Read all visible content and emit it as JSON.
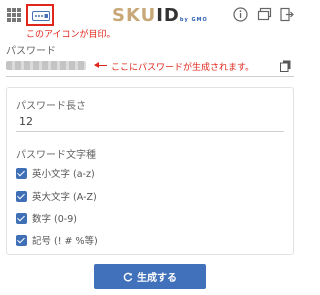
{
  "header": {
    "logo_sku": "SKU",
    "logo_id": "ID",
    "logo_gmo": "by GMO"
  },
  "annotations": {
    "icon_note": "このアイコンが目印。",
    "password_note": "ここにパスワードが生成されます。"
  },
  "password": {
    "label": "パスワード"
  },
  "settings": {
    "length_label": "パスワード長さ",
    "length_value": "12",
    "charset_label": "パスワード文字種",
    "options": [
      {
        "label": "英小文字 (a-z)",
        "checked": true
      },
      {
        "label": "英大文字 (A-Z)",
        "checked": true
      },
      {
        "label": "数字 (0-9)",
        "checked": true
      },
      {
        "label": "記号 (! # %等)",
        "checked": true
      }
    ]
  },
  "generate_button": {
    "label": "生成する"
  },
  "colors": {
    "accent": "#4171bb",
    "annotation": "#e0261b",
    "logo_gold": "#c8a878"
  }
}
